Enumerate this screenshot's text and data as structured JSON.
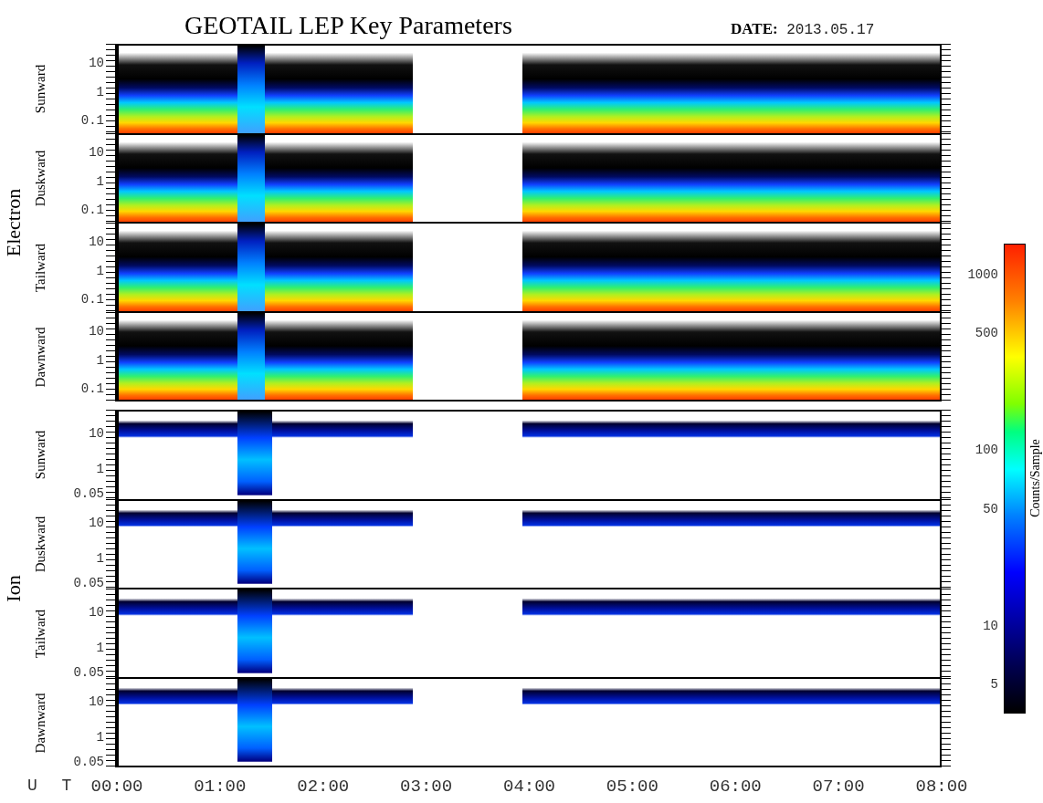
{
  "title": "GEOTAIL LEP Key Parameters",
  "date_label": "DATE:",
  "date_value": "2013.05.17",
  "groups": [
    {
      "name": "Electron",
      "kind": "electron",
      "panels": [
        {
          "label": "Sunward",
          "yticks": [
            "10",
            "1",
            "0.1"
          ]
        },
        {
          "label": "Duskward",
          "yticks": [
            "10",
            "1",
            "0.1"
          ]
        },
        {
          "label": "Tailward",
          "yticks": [
            "10",
            "1",
            "0.1"
          ]
        },
        {
          "label": "Dawnward",
          "yticks": [
            "10",
            "1",
            "0.1"
          ]
        }
      ]
    },
    {
      "name": "Ion",
      "kind": "ion",
      "panels": [
        {
          "label": "Sunward",
          "yticks": [
            "10",
            "1",
            "0.05"
          ]
        },
        {
          "label": "Duskward",
          "yticks": [
            "10",
            "1",
            "0.05"
          ]
        },
        {
          "label": "Tailward",
          "yticks": [
            "10",
            "1",
            "0.05"
          ]
        },
        {
          "label": "Dawnward",
          "yticks": [
            "10",
            "1",
            "0.05"
          ]
        }
      ]
    }
  ],
  "colorbar": {
    "label": "Counts/Sample",
    "ticks": [
      "1000",
      "500",
      "100",
      "50",
      "10",
      "5"
    ]
  },
  "x_axis": {
    "label": "U T",
    "ticks": [
      "00:00",
      "01:00",
      "02:00",
      "03:00",
      "04:00",
      "05:00",
      "06:00",
      "07:00",
      "08:00"
    ]
  }
}
